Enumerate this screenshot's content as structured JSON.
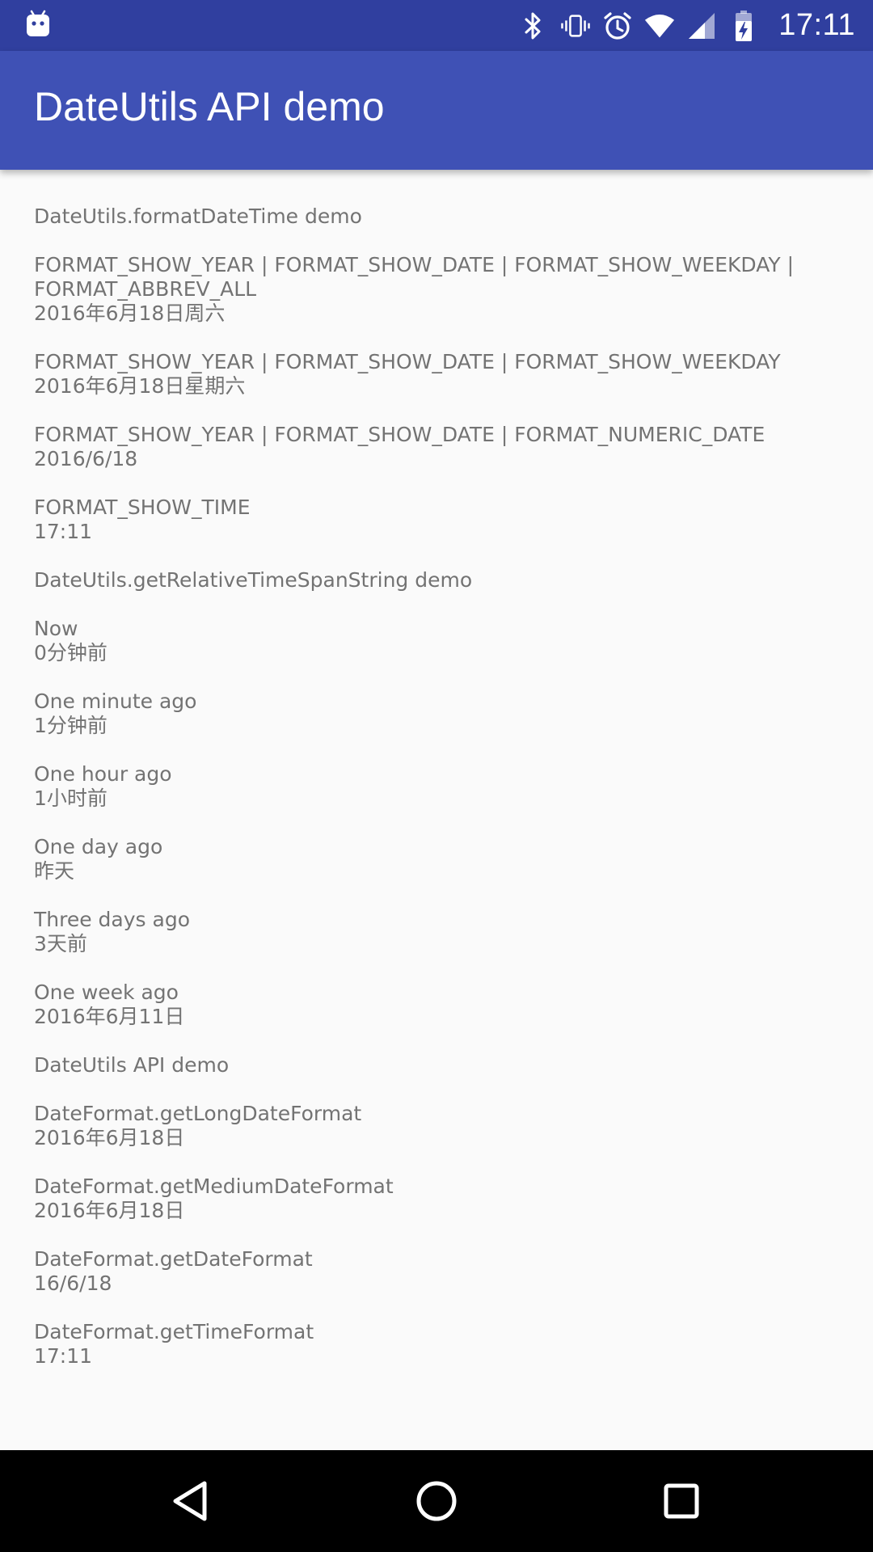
{
  "status_bar": {
    "time": "17:11",
    "icons": [
      "android-notification-icon",
      "bluetooth-icon",
      "vibrate-icon",
      "alarm-icon",
      "wifi-icon",
      "cell-signal-icon",
      "battery-charging-icon"
    ]
  },
  "app_bar": {
    "title": "DateUtils API demo"
  },
  "entries": [
    {
      "lines": [
        "DateUtils.formatDateTime demo"
      ]
    },
    {
      "lines": [
        "FORMAT_SHOW_YEAR | FORMAT_SHOW_DATE | FORMAT_SHOW_WEEKDAY |",
        "FORMAT_ABBREV_ALL",
        "2016年6月18日周六"
      ]
    },
    {
      "lines": [
        "FORMAT_SHOW_YEAR | FORMAT_SHOW_DATE | FORMAT_SHOW_WEEKDAY",
        "2016年6月18日星期六"
      ]
    },
    {
      "lines": [
        "FORMAT_SHOW_YEAR | FORMAT_SHOW_DATE | FORMAT_NUMERIC_DATE",
        "2016/6/18"
      ]
    },
    {
      "lines": [
        "FORMAT_SHOW_TIME",
        "17:11"
      ]
    },
    {
      "lines": [
        "DateUtils.getRelativeTimeSpanString demo"
      ]
    },
    {
      "lines": [
        "Now",
        "0分钟前"
      ]
    },
    {
      "lines": [
        "One minute ago",
        "1分钟前"
      ]
    },
    {
      "lines": [
        "One hour ago",
        "1小时前"
      ]
    },
    {
      "lines": [
        "One day ago",
        "昨天"
      ]
    },
    {
      "lines": [
        "Three days ago",
        "3天前"
      ]
    },
    {
      "lines": [
        "One week ago",
        "2016年6月11日"
      ]
    },
    {
      "lines": [
        "DateUtils API demo"
      ]
    },
    {
      "lines": [
        "DateFormat.getLongDateFormat",
        "2016年6月18日"
      ]
    },
    {
      "lines": [
        "DateFormat.getMediumDateFormat",
        "2016年6月18日"
      ]
    },
    {
      "lines": [
        "DateFormat.getDateFormat",
        "16/6/18"
      ]
    },
    {
      "lines": [
        "DateFormat.getTimeFormat",
        "17:11"
      ]
    }
  ],
  "nav_bar": {
    "buttons": [
      "back-icon",
      "home-icon",
      "recents-icon"
    ]
  },
  "colors": {
    "status_bar": "#303f9f",
    "app_bar": "#3f51b5",
    "background": "#fafafa",
    "text": "#737373",
    "nav_bar": "#000000"
  }
}
